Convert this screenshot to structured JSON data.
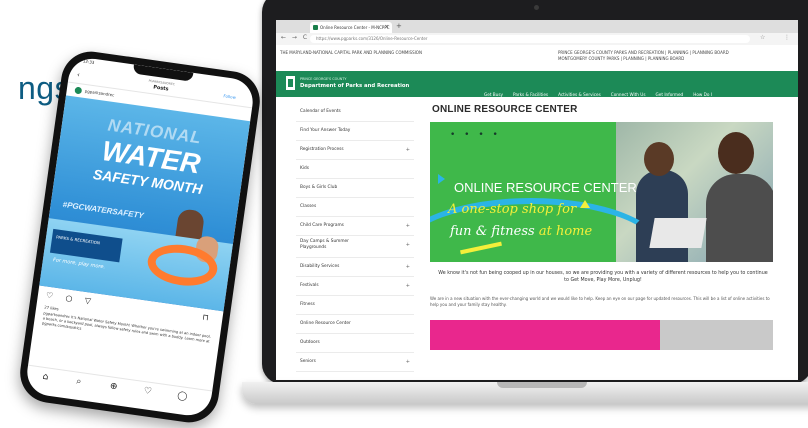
{
  "side_text": "ngs",
  "browser": {
    "tab_title": "Online Resource Center - M-NCPPC",
    "url": "https://www.pgparks.com/3126/Online-Resource-Center",
    "new_tab": "+",
    "nav_arrows": "← → C",
    "star": "☆",
    "menu": "⋮"
  },
  "site": {
    "top_left": "THE MARYLAND-NATIONAL CAPITAL PARK AND PLANNING COMMISSION",
    "top_right_1": "PRINCE GEORGE'S COUNTY  PARKS AND RECREATION | PLANNING | PLANNING BOARD",
    "top_right_2": "MONTGOMERY COUNTY  PARKS | PLANNING | PLANNING BOARD",
    "dept_small": "PRINCE GEORGE'S COUNTY",
    "dept_name": "Department of Parks and Recreation",
    "nav": [
      "Get Busy",
      "Parks & Facilities",
      "Activities & Services",
      "Connect With Us",
      "Get Informed",
      "How Do I"
    ]
  },
  "sidebar": {
    "items": [
      {
        "label": "Calendar of Events",
        "arrow": ""
      },
      {
        "label": "Find Your Answer Today",
        "arrow": ""
      },
      {
        "label": "Registration Process",
        "arrow": "+"
      },
      {
        "label": "Kids",
        "arrow": ""
      },
      {
        "label": "Boys & Girls Club",
        "arrow": ""
      },
      {
        "label": "Classes",
        "arrow": ""
      },
      {
        "label": "Child Care Programs",
        "arrow": "+"
      },
      {
        "label": "Day Camps & Summer Playgrounds",
        "arrow": "+"
      },
      {
        "label": "Disability Services",
        "arrow": "+"
      },
      {
        "label": "Festivals",
        "arrow": "+"
      },
      {
        "label": "Fitness",
        "arrow": ""
      },
      {
        "label": "Online Resource Center",
        "arrow": ""
      },
      {
        "label": "Outdoors",
        "arrow": ""
      },
      {
        "label": "Seniors",
        "arrow": "+"
      }
    ]
  },
  "main": {
    "title": "ONLINE RESOURCE CENTER",
    "banner_dots": "• • • •",
    "banner_title": "ONLINE RESOURCE CENTER",
    "banner_line1": "A one-stop shop for",
    "banner_line2a": "fun & fitness ",
    "banner_line2b": "at home",
    "welcome": "We know it's not fun being cooped up in our houses, so we are providing you with a variety of different resources to help you to continue to Get Move, Play More, Unplug!",
    "body": "We are in a new situation with the ever-changing world and we would like to help. Keep an eye on our page for updated resources. This will be a list of online activities to help you and your family stay healthy."
  },
  "phone": {
    "time": "12:33",
    "handle": "PGPARKSANDREC",
    "posts_label": "Posts",
    "follow": "Follow",
    "username": "pgparksandrec",
    "post_national": "NATIONAL",
    "post_water": "WATER",
    "post_safety": "SAFETY MONTH",
    "post_hashtag": "#PGCWATERSAFETY",
    "post_logo": "PARKS & RECREATION",
    "post_tagline": "For more, play more.",
    "actions": "♡ ○ ▽",
    "bookmark": "⊓",
    "likes": "27 likes",
    "caption": "pgparksandrec It's National Water Safety Month! Whether you're swimming at an indoor pool, a beach, or a backyard pool, always follow safety rules and swim with a buddy. Learn more at pgparks.com/aquatics",
    "nav_icons": [
      "⌂",
      "⌕",
      "⊕",
      "♡",
      "◯"
    ]
  }
}
